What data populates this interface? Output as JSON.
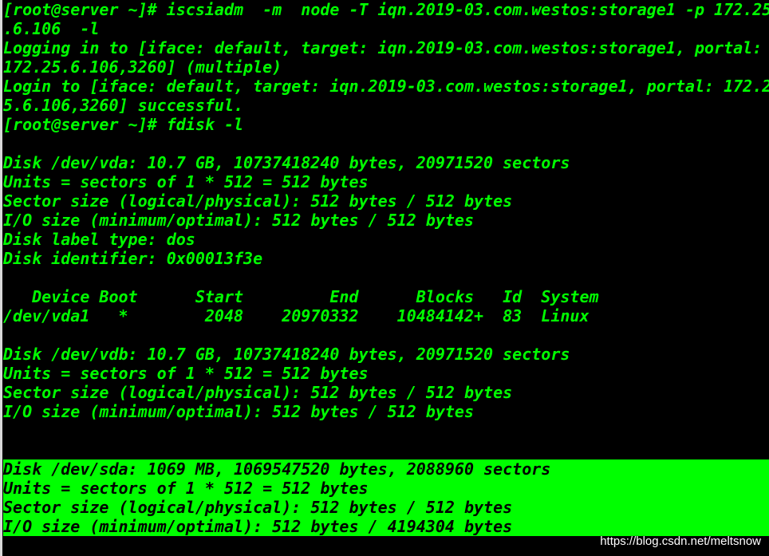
{
  "terminal": {
    "lines": [
      "[root@server ~]# iscsiadm  -m  node -T iqn.2019-03.com.westos:storage1 -p 172.25",
      ".6.106  -l",
      "Logging in to [iface: default, target: iqn.2019-03.com.westos:storage1, portal:",
      "172.25.6.106,3260] (multiple)",
      "Login to [iface: default, target: iqn.2019-03.com.westos:storage1, portal: 172.2",
      "5.6.106,3260] successful.",
      "[root@server ~]# fdisk -l",
      "",
      "Disk /dev/vda: 10.7 GB, 10737418240 bytes, 20971520 sectors",
      "Units = sectors of 1 * 512 = 512 bytes",
      "Sector size (logical/physical): 512 bytes / 512 bytes",
      "I/O size (minimum/optimal): 512 bytes / 512 bytes",
      "Disk label type: dos",
      "Disk identifier: 0x00013f3e",
      "",
      "   Device Boot      Start         End      Blocks   Id  System",
      "/dev/vda1   *        2048    20970332    10484142+  83  Linux",
      "",
      "Disk /dev/vdb: 10.7 GB, 10737418240 bytes, 20971520 sectors",
      "Units = sectors of 1 * 512 = 512 bytes",
      "Sector size (logical/physical): 512 bytes / 512 bytes",
      "I/O size (minimum/optimal): 512 bytes / 512 bytes",
      "",
      "",
      "Disk /dev/sda: 1069 MB, 1069547520 bytes, 2088960 sectors",
      "Units = sectors of 1 * 512 = 512 bytes",
      "Sector size (logical/physical): 512 bytes / 512 bytes",
      "I/O size (minimum/optimal): 512 bytes / 4194304 bytes"
    ],
    "highlighted_line_indices": [
      24,
      25,
      26,
      27
    ],
    "colors": {
      "background": "#000000",
      "text": "#00ff00",
      "highlight_bg": "#00ff00",
      "highlight_text": "#000000"
    }
  },
  "watermark": {
    "text": "https://blog.csdn.net/meltsnow"
  }
}
